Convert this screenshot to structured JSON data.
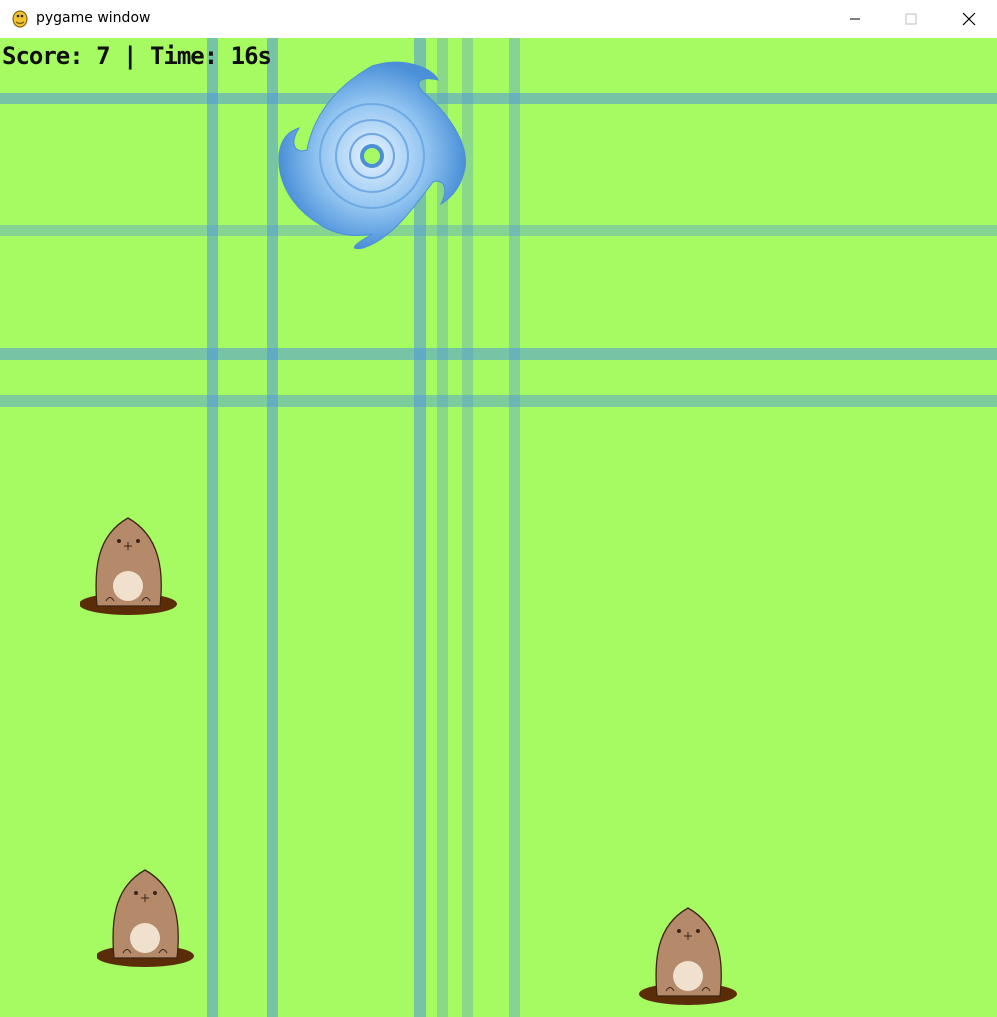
{
  "window": {
    "title": "pygame window",
    "app_icon": "pygame-snake-icon",
    "controls": [
      "minimize-icon",
      "maximize-icon",
      "close-icon"
    ]
  },
  "game": {
    "background_color": "#a6fb62",
    "line_color": "#5096dc",
    "hud": {
      "text": "Score: 7 | Time: 16s"
    },
    "sprites": [
      {
        "type": "tornado",
        "icon": "tornado-icon"
      },
      {
        "type": "mole",
        "icon": "mole-icon"
      },
      {
        "type": "mole",
        "icon": "mole-icon"
      },
      {
        "type": "mole",
        "icon": "mole-icon"
      }
    ]
  }
}
